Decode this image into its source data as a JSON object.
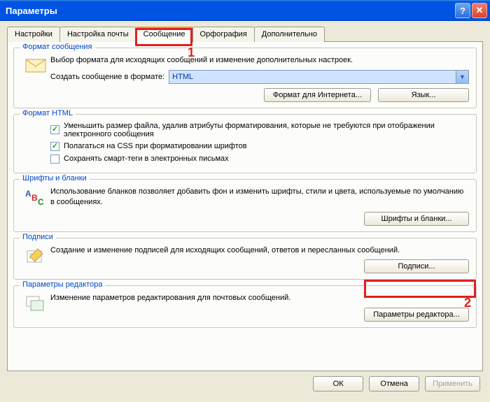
{
  "window": {
    "title": "Параметры"
  },
  "tabs": {
    "settings": "Настройки",
    "mail_setup": "Настройка почты",
    "compose": "Сообщение",
    "spelling": "Орфография",
    "advanced": "Дополнительно"
  },
  "group_message_format": {
    "title": "Формат сообщения",
    "desc": "Выбор формата для исходящих сообщений и изменение дополнительных настроек.",
    "create_label": "Создать сообщение в формате:",
    "format_value": "HTML",
    "btn_internet": "Формат для Интернета...",
    "btn_lang": "Язык..."
  },
  "group_html": {
    "title": "Формат HTML",
    "chk_reduce": "Уменьшить размер файла, удалив атрибуты форматирования, которые не требуются при отображении электронного сообщения",
    "chk_css": "Полагаться на CSS при форматировании шрифтов",
    "chk_smart": "Сохранять смарт-теги в электронных письмах"
  },
  "group_fonts": {
    "title": "Шрифты и бланки",
    "desc": "Использование бланков позволяет добавить фон и изменить шрифты, стили и цвета, используемые по умолчанию в сообщениях.",
    "btn": "Шрифты и бланки..."
  },
  "group_sign": {
    "title": "Подписи",
    "desc": "Создание и изменение подписей для исходящих сообщений, ответов и пересланных сообщений.",
    "btn": "Подписи..."
  },
  "group_editor": {
    "title": "Параметры редактора",
    "desc": "Изменение параметров редактирования для почтовых сообщений.",
    "btn": "Параметры редактора..."
  },
  "footer": {
    "ok": "ОК",
    "cancel": "Отмена",
    "apply": "Применить"
  },
  "annotations": {
    "one": "1",
    "two": "2"
  }
}
